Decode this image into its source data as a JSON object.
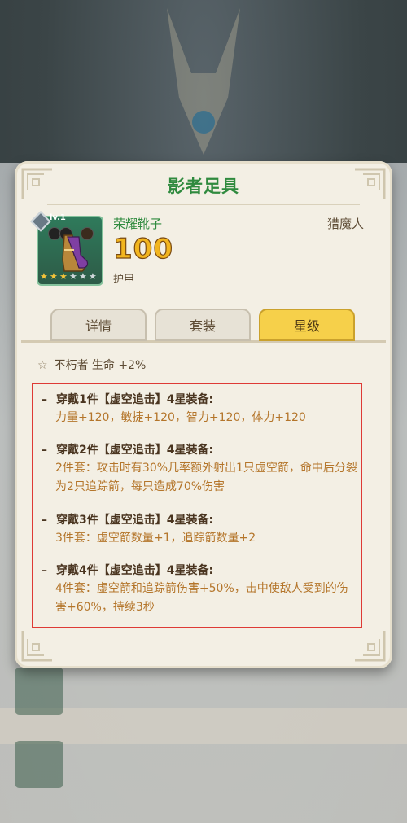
{
  "panel": {
    "title": "影者足具"
  },
  "item": {
    "name": "荣耀靴子",
    "level": "lv.1",
    "value": "100",
    "stat": "护甲",
    "class": "猎魔人",
    "stars_filled": 3,
    "stars_total": 6
  },
  "tabs": [
    {
      "label": "详情",
      "active": false
    },
    {
      "label": "套装",
      "active": false
    },
    {
      "label": "星级",
      "active": true
    }
  ],
  "star_bonus": {
    "text": "不朽者 生命 +2%"
  },
  "set_entries": [
    {
      "dash": "–",
      "head": "穿戴1件【虚空追击】4星装备:",
      "desc": "力量+120，敏捷+120，智力+120，体力+120"
    },
    {
      "dash": "–",
      "head": "穿戴2件【虚空追击】4星装备:",
      "desc": "2件套：攻击时有30%几率额外射出1只虚空箭，命中后分裂为2只追踪箭，每只造成70%伤害"
    },
    {
      "dash": "–",
      "head": "穿戴3件【虚空追击】4星装备:",
      "desc": "3件套：虚空箭数量+1，追踪箭数量+2"
    },
    {
      "dash": "–",
      "head": "穿戴4件【虚空追击】4星装备:",
      "desc": "4件套：虚空箭和追踪箭伤害+50%，击中使敌人受到的伤害+60%，持续3秒"
    }
  ],
  "colors": {
    "title_green": "#2f8a3e",
    "active_tab": "#f6d04a",
    "desc_orange": "#b4752a",
    "highlight_border": "#de3a35"
  }
}
